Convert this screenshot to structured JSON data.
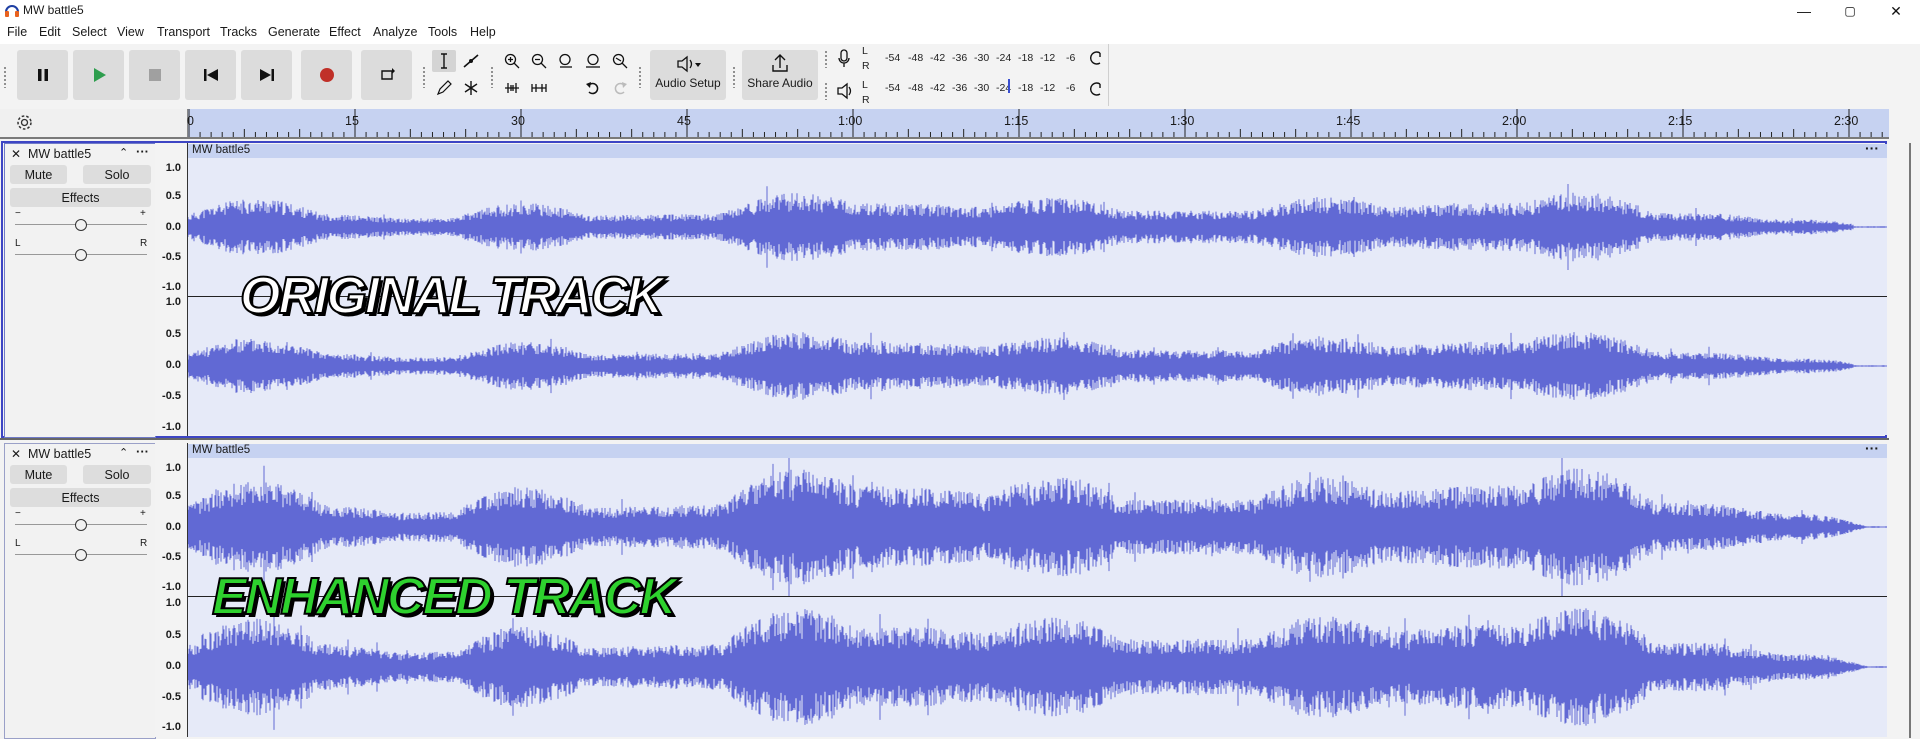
{
  "window": {
    "title": "MW battle5",
    "controls": {
      "minimize": "—",
      "maximize": "▢",
      "close": "✕"
    }
  },
  "menu": [
    "File",
    "Edit",
    "Select",
    "View",
    "Transport",
    "Tracks",
    "Generate",
    "Effect",
    "Analyze",
    "Tools",
    "Help"
  ],
  "toolbar": {
    "audio_setup_label": "Audio Setup",
    "share_audio_label": "Share Audio",
    "record_meter": {
      "channels": [
        "L",
        "R"
      ],
      "scale": [
        "-54",
        "-48",
        "-42",
        "-36",
        "-30",
        "-24",
        "-18",
        "-12",
        "-6"
      ]
    },
    "play_meter": {
      "channels": [
        "L",
        "R"
      ],
      "scale": [
        "-54",
        "-48",
        "-42",
        "-36",
        "-30",
        "-24",
        "-18",
        "-12",
        "-6"
      ]
    }
  },
  "ruler": {
    "ticks": [
      "0",
      "15",
      "30",
      "45",
      "1:00",
      "1:15",
      "1:30",
      "1:45",
      "2:00",
      "2:15",
      "2:30"
    ]
  },
  "tracks": [
    {
      "name": "MW battle5",
      "clip_name": "MW battle5",
      "mute_label": "Mute",
      "solo_label": "Solo",
      "effects_label": "Effects",
      "gain_minus": "−",
      "gain_plus": "+",
      "pan_left": "L",
      "pan_right": "R",
      "overlay": "ORIGINAL TRACK",
      "scale": [
        "1.0",
        "0.5",
        "0.0",
        "-0.5",
        "-1.0"
      ],
      "scale2": [
        "1.0",
        "0.5",
        "0.0",
        "-0.5",
        "-1.0"
      ]
    },
    {
      "name": "MW battle5",
      "clip_name": "MW battle5",
      "mute_label": "Mute",
      "solo_label": "Solo",
      "effects_label": "Effects",
      "gain_minus": "−",
      "gain_plus": "+",
      "pan_left": "L",
      "pan_right": "R",
      "overlay": "ENHANCED TRACK",
      "scale": [
        "1.0",
        "0.5",
        "0.0",
        "-0.5",
        "-1.0"
      ],
      "scale2": [
        "1.0",
        "0.5",
        "0.0",
        "-0.5",
        "-1.0"
      ]
    }
  ],
  "colors": {
    "waveform": "#6169d4",
    "ruler": "#c6d2f1",
    "selection_border": "#3d45c4",
    "enhanced_text": "#2ed12e"
  }
}
